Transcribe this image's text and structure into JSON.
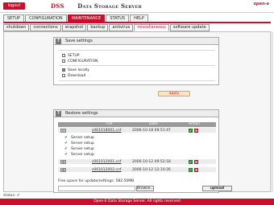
{
  "header": {
    "logout_label": "logout",
    "title_short": "DSS",
    "title_long": "Data Storage Server",
    "logo_text": "open-e"
  },
  "main_tabs": [
    "SETUP",
    "CONFIGURATION",
    "MAINTENANCE",
    "STATUS",
    "HELP"
  ],
  "main_tab_active": "MAINTENANCE",
  "sub_tabs": [
    "shutdown",
    "connections",
    "snapshot",
    "backup",
    "antivirus",
    "miscellaneous",
    "software update"
  ],
  "sub_tab_active": "miscellaneous",
  "save_settings": {
    "help_icon": "?",
    "title": "Save settings",
    "options": [
      {
        "label": "SETUP",
        "checked": false
      },
      {
        "label": "CONFIGURATION",
        "checked": false
      }
    ],
    "targets": [
      {
        "label": "Save locally",
        "checked": true
      },
      {
        "label": "Download",
        "checked": false
      }
    ],
    "apply_label": "apply"
  },
  "restore_settings": {
    "help_icon": "?",
    "title": "Restore settings",
    "columns": [
      "File",
      "Date",
      "Action"
    ],
    "rows": [
      {
        "file": "s061018001.cnf",
        "date": "2006-10-18 09:51:47",
        "expanded": true,
        "items": [
          "Server setup",
          "Server setup",
          "Server setup",
          "Server setup"
        ]
      },
      {
        "file": "s061012001.cnf",
        "date": "2006-10-12 09:52:18",
        "expanded": false,
        "items": []
      },
      {
        "file": "s061012002.cnf",
        "date": "2006-10-12 12:10:26",
        "expanded": false,
        "items": []
      }
    ],
    "free_space": "Free space for update/settings: 582.50MB",
    "browse_label": "Browse...",
    "upload_label": "upload"
  },
  "status": {
    "label": "status:"
  },
  "footer": {
    "text": "Open-E Data Storage Server. All rights reserved"
  },
  "colors": {
    "accent": "#c8102e",
    "ok": "#2f7a2f"
  }
}
